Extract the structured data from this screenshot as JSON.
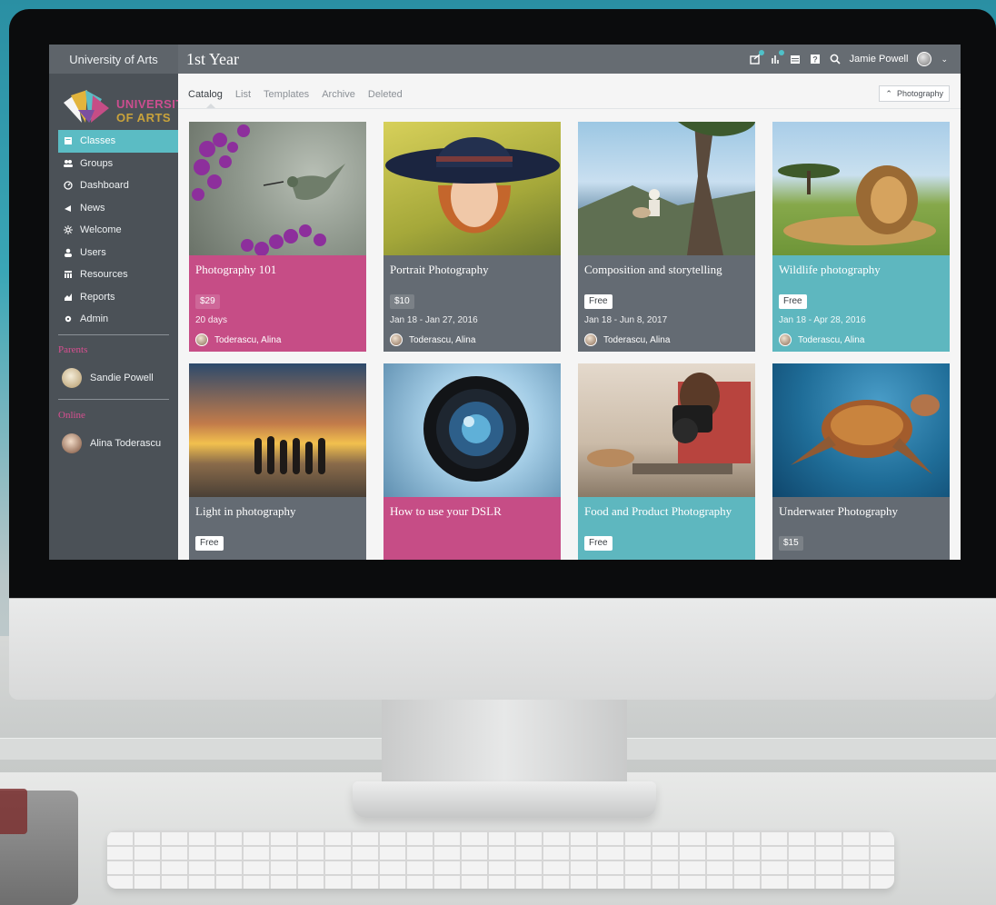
{
  "topbar": {
    "org_name": "University of Arts",
    "page_title": "1st Year",
    "user_name": "Jamie Powell"
  },
  "logo": {
    "line1": "UNIVERSITY",
    "line2": "OF ARTS"
  },
  "sidebar": {
    "items": [
      {
        "label": "Classes",
        "icon": "classes-icon",
        "active": true
      },
      {
        "label": "Groups",
        "icon": "groups-icon"
      },
      {
        "label": "Dashboard",
        "icon": "dashboard-icon"
      },
      {
        "label": "News",
        "icon": "news-icon"
      },
      {
        "label": "Welcome",
        "icon": "welcome-icon"
      },
      {
        "label": "Users",
        "icon": "users-icon"
      },
      {
        "label": "Resources",
        "icon": "resources-icon"
      },
      {
        "label": "Reports",
        "icon": "reports-icon"
      },
      {
        "label": "Admin",
        "icon": "admin-icon"
      }
    ],
    "parents_heading": "Parents",
    "parent_user": "Sandie Powell",
    "online_heading": "Online",
    "online_user": "Alina Toderascu"
  },
  "tabs": [
    "Catalog",
    "List",
    "Templates",
    "Archive",
    "Deleted"
  ],
  "filter_label": "Photography",
  "cards": [
    {
      "title": "Photography 101",
      "price": "$29",
      "dates": "20 days",
      "teacher": "Toderascu, Alina",
      "color": "pink"
    },
    {
      "title": "Portrait Photography",
      "price": "$10",
      "dates": "Jan 18 - Jan 27, 2016",
      "teacher": "Toderascu, Alina",
      "color": "slate"
    },
    {
      "title": "Composition and storytelling",
      "price": "Free",
      "dates": "Jan 18 - Jun 8, 2017",
      "teacher": "Toderascu, Alina",
      "color": "slate"
    },
    {
      "title": "Wildlife photography",
      "price": "Free",
      "dates": "Jan 18 - Apr 28, 2016",
      "teacher": "Toderascu, Alina",
      "color": "teal"
    },
    {
      "title": "Light in photography",
      "price": "Free",
      "color": "slate"
    },
    {
      "title": "How to use your DSLR",
      "color": "pink"
    },
    {
      "title": "Food and Product Photography",
      "price": "Free",
      "color": "teal"
    },
    {
      "title": "Underwater Photography",
      "price": "$15",
      "color": "slate"
    }
  ],
  "colors": {
    "accent_teal": "#5bbcc4",
    "accent_pink": "#c64d86",
    "card_slate": "#646b73",
    "sidebar_bg": "#4b5157",
    "topbar_bg": "#666c72"
  }
}
